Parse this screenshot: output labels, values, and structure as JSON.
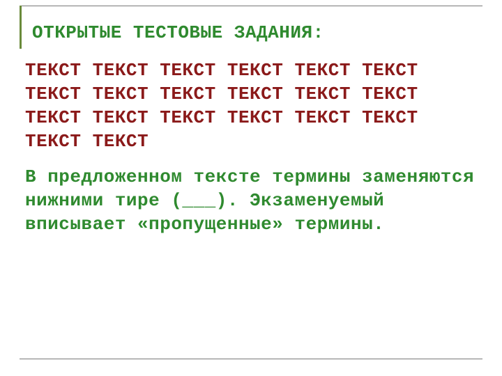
{
  "heading": "ОТКРЫТЫЕ ТЕСТОВЫЕ ЗАДАНИЯ:",
  "sample_text": "ТЕКСТ ТЕКСТ ТЕКСТ ТЕКСТ ТЕКСТ ТЕКСТ ТЕКСТ ТЕКСТ ТЕКСТ ТЕКСТ ТЕКСТ ТЕКСТ ТЕКСТ ТЕКСТ ТЕКСТ ТЕКСТ ТЕКСТ ТЕКСТ ТЕКСТ ТЕКСТ",
  "instruction": "В предложенном тексте термины заменяются нижними тире (___). Экзаменуемый вписывает «пропущенные» термины."
}
